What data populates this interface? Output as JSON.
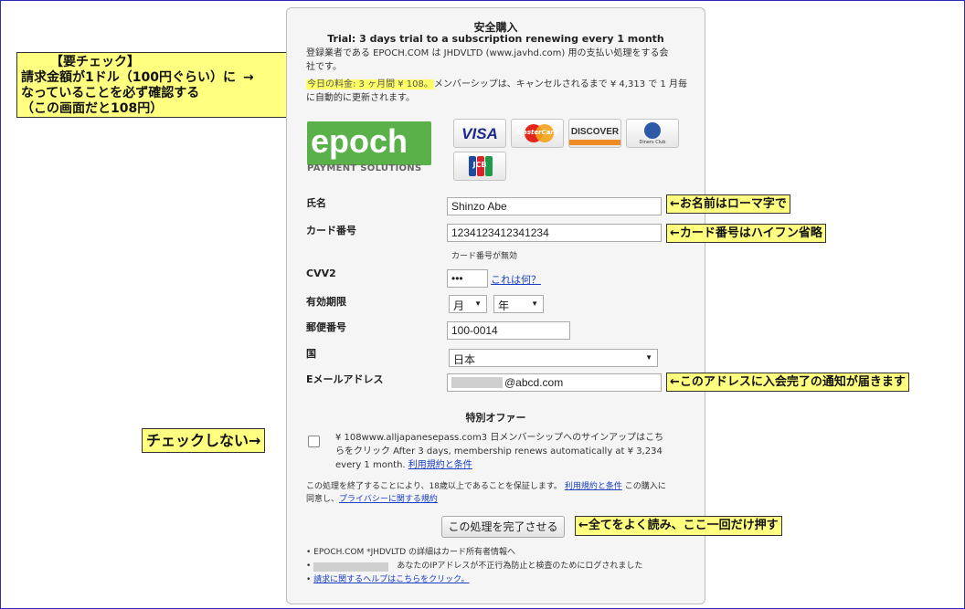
{
  "header": {
    "title": "安全購入",
    "subtitle": "Trial: 3 days trial to a subscription renewing every 1 month",
    "desc_line1": "登録業者である EPOCH.COM は JHDVLTD (www.javhd.com) 用の支払い処理をする会",
    "desc_line2": "社です。",
    "charge_highlight": "今日の料金: 3 ヶ月間 ¥ 108。",
    "charge_rest": "メンバーシップは、キャンセルされるまで ¥ 4,313 で 1 月毎",
    "charge_line2": "に自動的に更新されます。"
  },
  "brand": {
    "logo_text": "epoch",
    "logo_sub": "PAYMENT SOLUTIONS",
    "logo_color": "#5ab14a",
    "cards": [
      "VISA",
      "MasterCard",
      "DISCOVER",
      "Diners Club",
      "JCB"
    ]
  },
  "form": {
    "name_label": "氏名",
    "name_value": "Shinzo Abe",
    "card_label": "カード番号",
    "card_value": "1234123412341234",
    "card_error": "カード番号が無効",
    "cvv_label": "CVV2",
    "cvv_value": "•••",
    "cvv_help": "これは何？",
    "expiry_label": "有効期限",
    "month_value": "月",
    "year_value": "年",
    "zip_label": "郵便番号",
    "zip_value": "100-0014",
    "country_label": "国",
    "country_value": "日本",
    "email_label": "Eメールアドレス",
    "email_value": "@abcd.com"
  },
  "offer": {
    "heading": "特別オファー",
    "line1": "¥ 108www.alljapanesepass.com3 日メンバーシップへのサインアップはこち",
    "line2": "らをクリック  After 3 days, membership renews automatically at ¥ 3,234",
    "line3": "every 1 month.",
    "terms_link": "利用規約と条件"
  },
  "agreement": {
    "line1": "この処理を終了することにより、18歳以上であることを保証します。",
    "terms_link": "利用規約と条件",
    "line1_end": "この購入に",
    "line2": "同意し、",
    "privacy_link": "プライバシーに関する規約"
  },
  "submit_label": "この処理を完了させる",
  "footer": {
    "item1": "• EPOCH.COM *JHDVLTD の詳細はカード所有者情報へ",
    "item2": "あなたのIPアドレスが不正行為防止と検査のためにログされました",
    "item3_link": "請求に関するヘルプはこちらをクリック。"
  },
  "annotations": {
    "check_title": "【要チェック】",
    "check_line1": "請求金額が1ドル（100円ぐらい）に",
    "check_line2": "なっていることを必ず確認する",
    "check_line3": "（この画面だと108円）",
    "name_note": "←お名前はローマ字で",
    "card_note": "←カード番号はハイフン省略",
    "email_note": "←このアドレスに入会完了の通知が届きます",
    "nocheck_note": "チェックしない→",
    "submit_note": "←全てをよく読み、ここ一回だけ押す",
    "arrow": "→"
  }
}
